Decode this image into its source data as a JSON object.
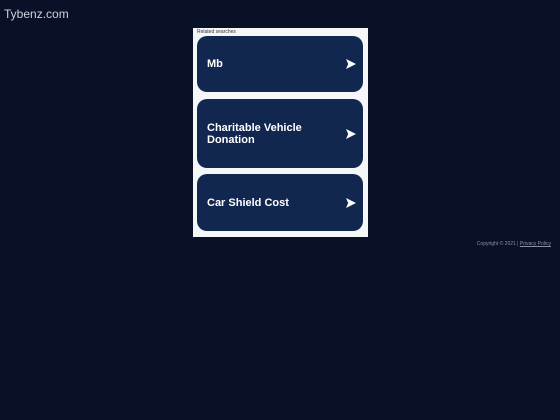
{
  "site": {
    "title": "Tybenz.com"
  },
  "related": {
    "heading": "Related searches",
    "items": [
      {
        "label": "Mb",
        "icon": "arrow-right-icon"
      },
      {
        "label": "Charitable Vehicle Donation",
        "icon": "arrow-right-icon"
      },
      {
        "label": "Car Shield Cost",
        "icon": "arrow-right-icon"
      }
    ]
  },
  "footer": {
    "copyright": "Copyright © 2021 |",
    "privacy_label": "Privacy Policy"
  },
  "colors": {
    "background": "#081127",
    "card": "#12274f",
    "panel": "#f4f6f8"
  }
}
